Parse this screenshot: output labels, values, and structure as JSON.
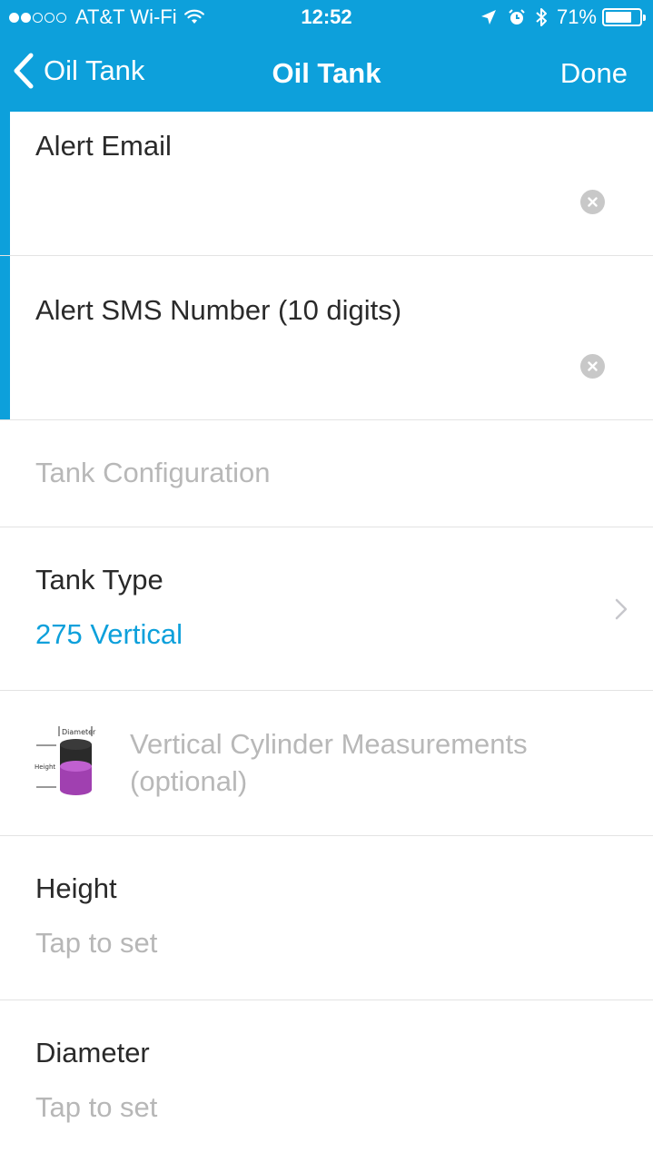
{
  "status_bar": {
    "carrier": "AT&T Wi-Fi",
    "time": "12:52",
    "battery": "71%",
    "signal_full_dots": 2,
    "signal_total_dots": 5
  },
  "nav": {
    "back_label": "Oil Tank",
    "title": "Oil Tank",
    "done_label": "Done"
  },
  "colors": {
    "accent": "#0da0db",
    "tank_fill": "#a040b0"
  },
  "form": {
    "alert_email": {
      "label": "Alert Email",
      "value": ""
    },
    "alert_sms": {
      "label": "Alert SMS Number (10 digits)",
      "value": ""
    },
    "tank_config_header": "Tank Configuration",
    "tank_type": {
      "label": "Tank Type",
      "value": "275 Vertical"
    },
    "measurements": {
      "title": "Vertical Cylinder Measurements",
      "subtitle": "(optional)",
      "diagram_diameter": "Diameter",
      "diagram_height": "Height"
    },
    "height": {
      "label": "Height",
      "placeholder": "Tap to set"
    },
    "diameter": {
      "label": "Diameter",
      "placeholder": "Tap to set"
    }
  }
}
